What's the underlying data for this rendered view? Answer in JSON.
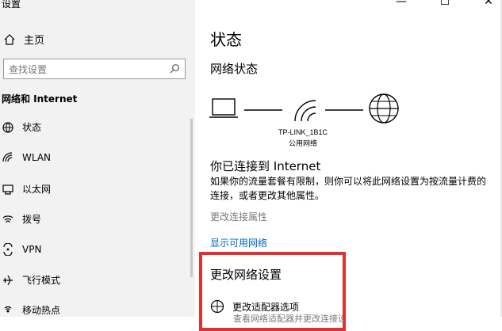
{
  "window": {
    "title": "设置",
    "controls": [
      "—",
      "☐",
      "✕"
    ]
  },
  "sidebar": {
    "home_label": "主页",
    "search_placeholder": "查找设置",
    "section_title": "网络和 Internet",
    "items": [
      {
        "label": "状态",
        "icon": "status-icon"
      },
      {
        "label": "WLAN",
        "icon": "wifi-icon"
      },
      {
        "label": "以太网",
        "icon": "ethernet-icon"
      },
      {
        "label": "拨号",
        "icon": "dialup-icon"
      },
      {
        "label": "VPN",
        "icon": "vpn-icon"
      },
      {
        "label": "飞行模式",
        "icon": "airplane-icon"
      },
      {
        "label": "移动热点",
        "icon": "hotspot-icon"
      }
    ]
  },
  "main": {
    "title": "状态",
    "network_status_title": "网络状态",
    "network_name": "TP-LINK_1B1C",
    "network_type": "公用网络",
    "connected_title": "你已连接到 Internet",
    "connected_desc": "如果你的流量套餐有限制，则你可以将此网络设置为按流量计费的连接，或者更改其他属性。",
    "change_props_link": "更改连接属性",
    "show_networks_link": "显示可用网络",
    "change_settings_title": "更改网络设置",
    "adapter_title": "更改适配器选项",
    "adapter_subtitle": "查看网络适配器并更改连接设置。"
  },
  "colors": {
    "sidebar_bg": "#f2f2f2",
    "link_blue": "#0067c0",
    "highlight_red": "#e1302f"
  }
}
